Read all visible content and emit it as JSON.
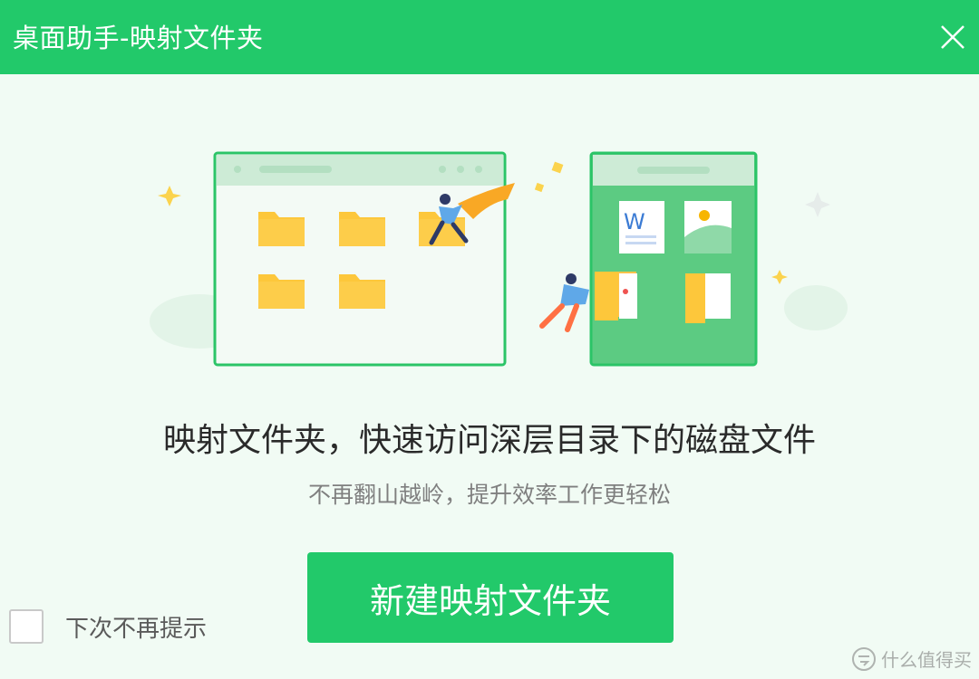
{
  "window": {
    "title": "桌面助手-映射文件夹",
    "close_icon": "close-icon"
  },
  "main": {
    "heading": "映射文件夹，快速访问深层目录下的磁盘文件",
    "subheading": "不再翻山越岭，提升效率工作更轻松",
    "primary_button": "新建映射文件夹"
  },
  "footer": {
    "checkbox_label": "下次不再提示",
    "checkbox_checked": false
  },
  "watermark": {
    "text": "什么值得买"
  },
  "colors": {
    "brand_green": "#22c96a",
    "background": "#f1fbf4",
    "folder_yellow": "#fdc73b"
  }
}
